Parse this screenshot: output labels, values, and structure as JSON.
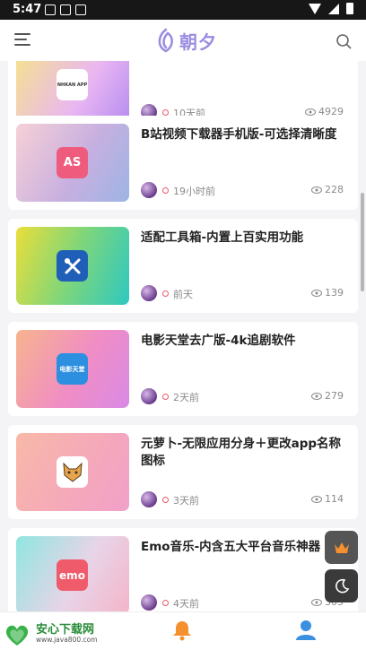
{
  "status_bar": {
    "time": "5:47"
  },
  "header": {
    "logo_text": "朝夕"
  },
  "cards": [
    {
      "title": "",
      "time": "10天前",
      "views": "4929",
      "icon_text": "NHKAN APP"
    },
    {
      "title": "B站视频下载器手机版-可选择清晰度",
      "time": "19小时前",
      "views": "228",
      "icon_text": "AS"
    },
    {
      "title": "适配工具箱-内置上百实用功能",
      "time": "前天",
      "views": "139",
      "icon_text": ""
    },
    {
      "title": "电影天堂去广版-4k追剧软件",
      "time": "2天前",
      "views": "279",
      "icon_text": "电影天堂"
    },
    {
      "title": "元萝卜-无限应用分身＋更改app名称图标",
      "time": "3天前",
      "views": "114",
      "icon_text": ""
    },
    {
      "title": "Emo音乐-内含五大平台音乐神器",
      "time": "4天前",
      "views": "305",
      "icon_text": "emo"
    }
  ],
  "watermark": {
    "title": "安心下载网",
    "url": "www.java800.com"
  },
  "colors": {
    "accent": "#9a8ce0",
    "dot": "#e8596b",
    "nav_bell": "#f5902e",
    "nav_user": "#3b8fe0"
  }
}
